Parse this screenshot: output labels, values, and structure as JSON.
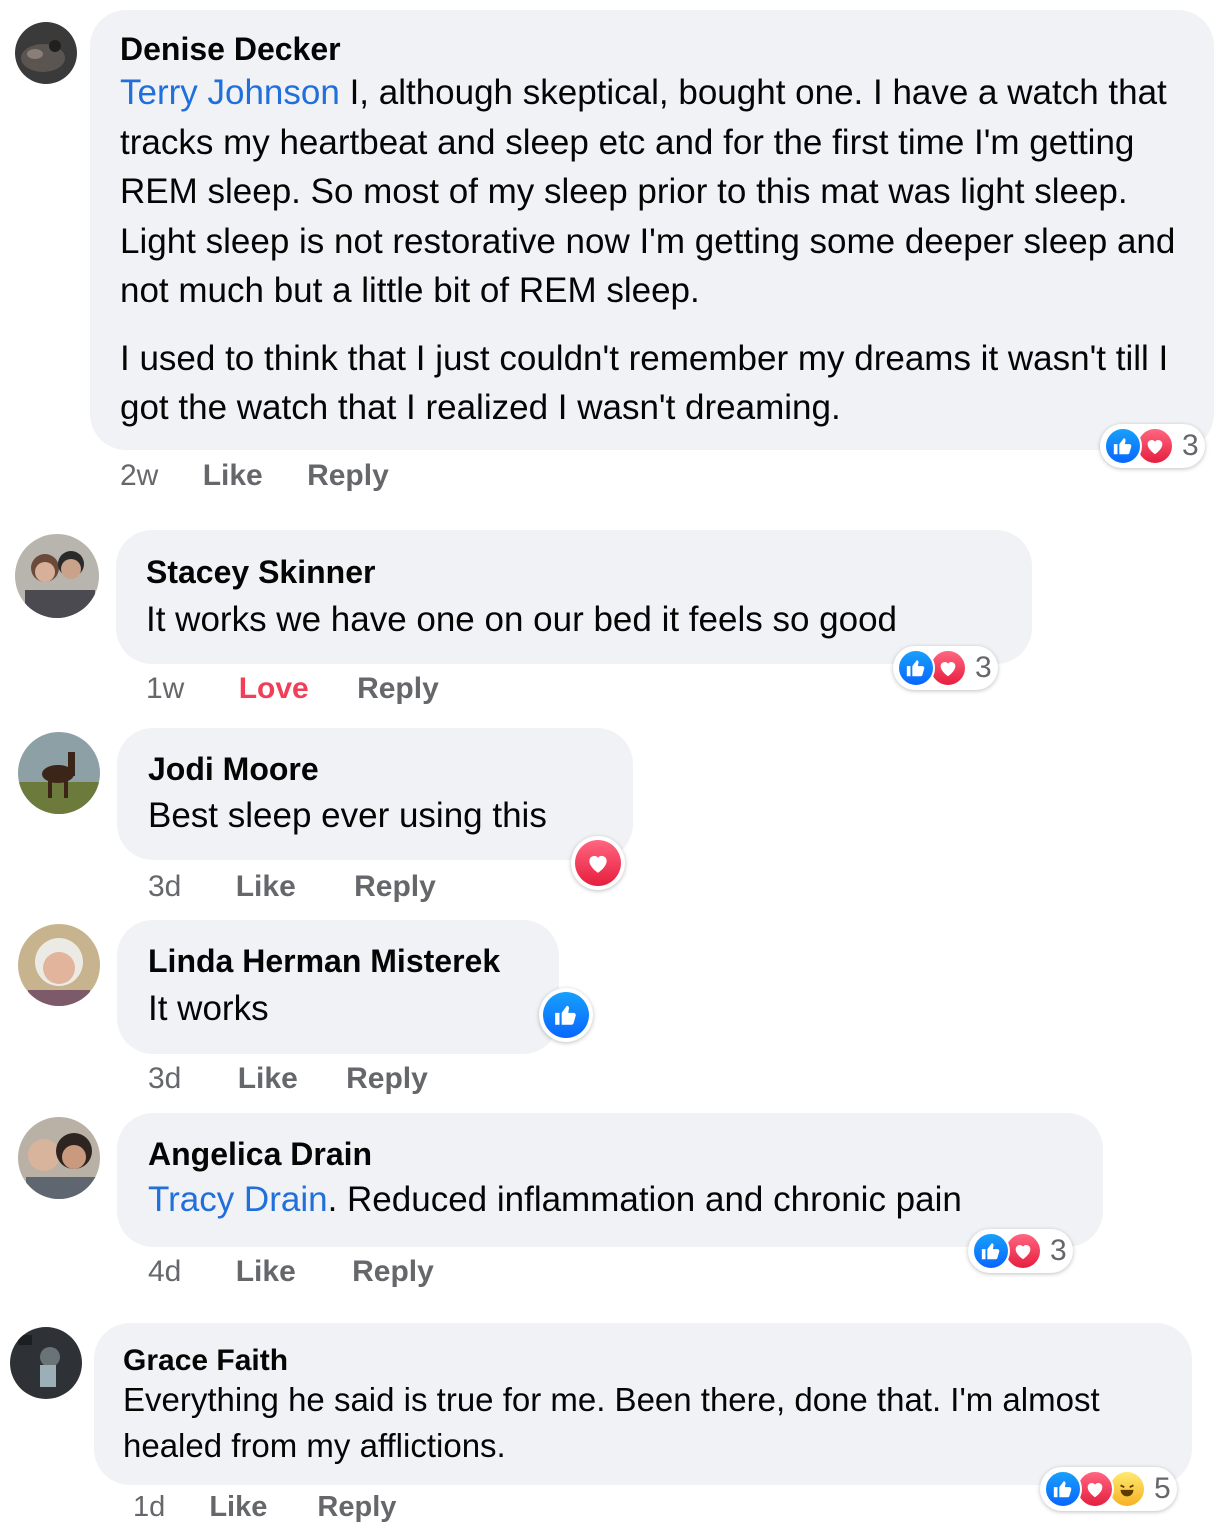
{
  "comments": [
    {
      "author": "Denise Decker",
      "mention": "Terry Johnson",
      "paragraphs": [
        "I, although skeptical, bought one. I have a watch that tracks my heartbeat and sleep etc and for the first time I'm getting REM sleep. So most of my sleep prior to this mat was light sleep. Light sleep is not restorative now I'm getting some deeper sleep and not much but a little bit of REM sleep.",
        "I used to think that I just couldn't remember my dreams it wasn't till I got the watch that I realized I wasn't dreaming."
      ],
      "time": "2w",
      "like_label": "Like",
      "reply_label": "Reply",
      "reactions": [
        "like",
        "love"
      ],
      "reaction_count": "3"
    },
    {
      "author": "Stacey Skinner",
      "text": "It works we have one on our bed it feels so good",
      "time": "1w",
      "like_label": "Love",
      "reply_label": "Reply",
      "reactions": [
        "like",
        "love"
      ],
      "reaction_count": "3"
    },
    {
      "author": "Jodi Moore",
      "text": "Best sleep ever using this",
      "time": "3d",
      "like_label": "Like",
      "reply_label": "Reply",
      "reactions": [
        "love"
      ]
    },
    {
      "author": "Linda Herman Misterek",
      "text": "It works",
      "time": "3d",
      "like_label": "Like",
      "reply_label": "Reply",
      "reactions": [
        "like"
      ]
    },
    {
      "author": "Angelica Drain",
      "mention": "Tracy Drain",
      "text": ". Reduced inflammation and chronic pain",
      "time": "4d",
      "like_label": "Like",
      "reply_label": "Reply",
      "reactions": [
        "like",
        "love"
      ],
      "reaction_count": "3"
    },
    {
      "author": "Grace Faith",
      "text": "Everything he said is true for me. Been there, done that. I'm almost healed from my afflictions.",
      "time": "1d",
      "like_label": "Like",
      "reply_label": "Reply",
      "reactions": [
        "like",
        "love",
        "haha"
      ],
      "reaction_count": "5"
    }
  ],
  "colors": {
    "bubble": "#f0f2f5",
    "mention": "#216fdb",
    "meta": "#65676b",
    "love_label": "#f33e58",
    "like_reaction": "#0866ff",
    "love_reaction": "#e61e3e",
    "haha_reaction": "#f7b125"
  },
  "icons": {
    "like": "thumbs-up-icon",
    "love": "heart-icon",
    "haha": "laughing-face-icon"
  }
}
